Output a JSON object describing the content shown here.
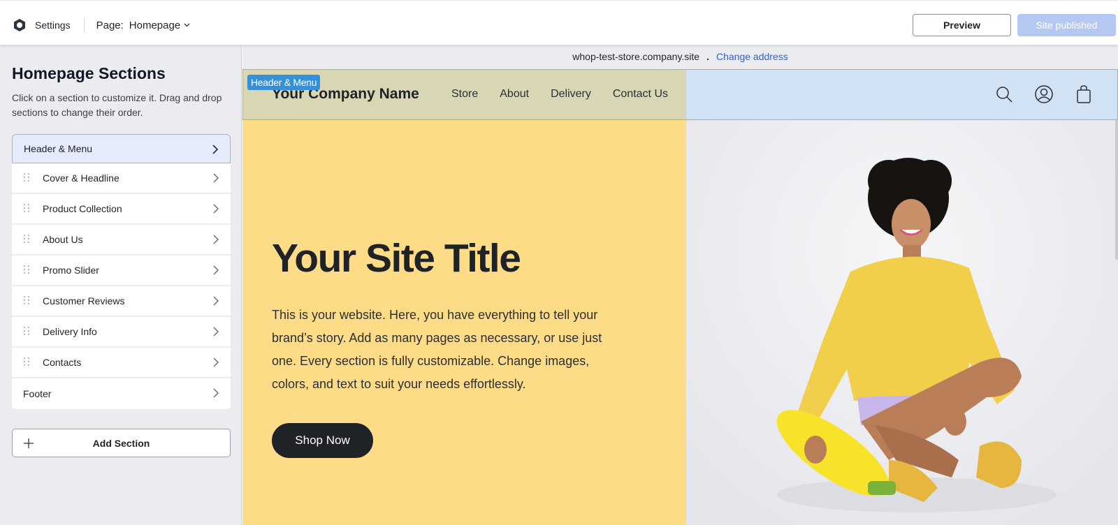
{
  "topbar": {
    "settings_label": "Settings",
    "page_label": "Page:",
    "page_value": "Homepage",
    "preview_label": "Preview",
    "published_label": "Site published"
  },
  "sidebar": {
    "title": "Homepage Sections",
    "description": "Click on a section to customize it. Drag and drop sections to change their order.",
    "items": [
      {
        "label": "Header & Menu",
        "draggable": false,
        "active": true
      },
      {
        "label": "Cover & Headline",
        "draggable": true
      },
      {
        "label": "Product Collection",
        "draggable": true
      },
      {
        "label": "About Us",
        "draggable": true
      },
      {
        "label": "Promo Slider",
        "draggable": true
      },
      {
        "label": "Customer Reviews",
        "draggable": true
      },
      {
        "label": "Delivery Info",
        "draggable": true
      },
      {
        "label": "Contacts",
        "draggable": true
      },
      {
        "label": "Footer",
        "draggable": false
      }
    ],
    "add_section_label": "Add Section"
  },
  "canvas": {
    "address": "whop-test-store.company.site",
    "separator": ".",
    "change_address_label": "Change address",
    "selected_section_tag": "Header & Menu",
    "site": {
      "company_name": "Your Company Name",
      "nav": [
        "Store",
        "About",
        "Delivery",
        "Contact Us"
      ],
      "icons": [
        "search-icon",
        "account-icon",
        "cart-bag-icon"
      ],
      "hero_title": "Your Site Title",
      "hero_text": "This is your website. Here, you have everything to tell your brand’s story. Add as many pages as necessary, or use just one. Every section is fully customizable. Change images, colors, and text to suit your needs effortlessly.",
      "cta_label": "Shop Now"
    }
  },
  "colors": {
    "accent_blue": "#2b62d3",
    "published_button": "#b5c8f2",
    "hero_yellow": "#fddb87",
    "selection_tag": "#3291d8",
    "dark": "#1f2328"
  }
}
